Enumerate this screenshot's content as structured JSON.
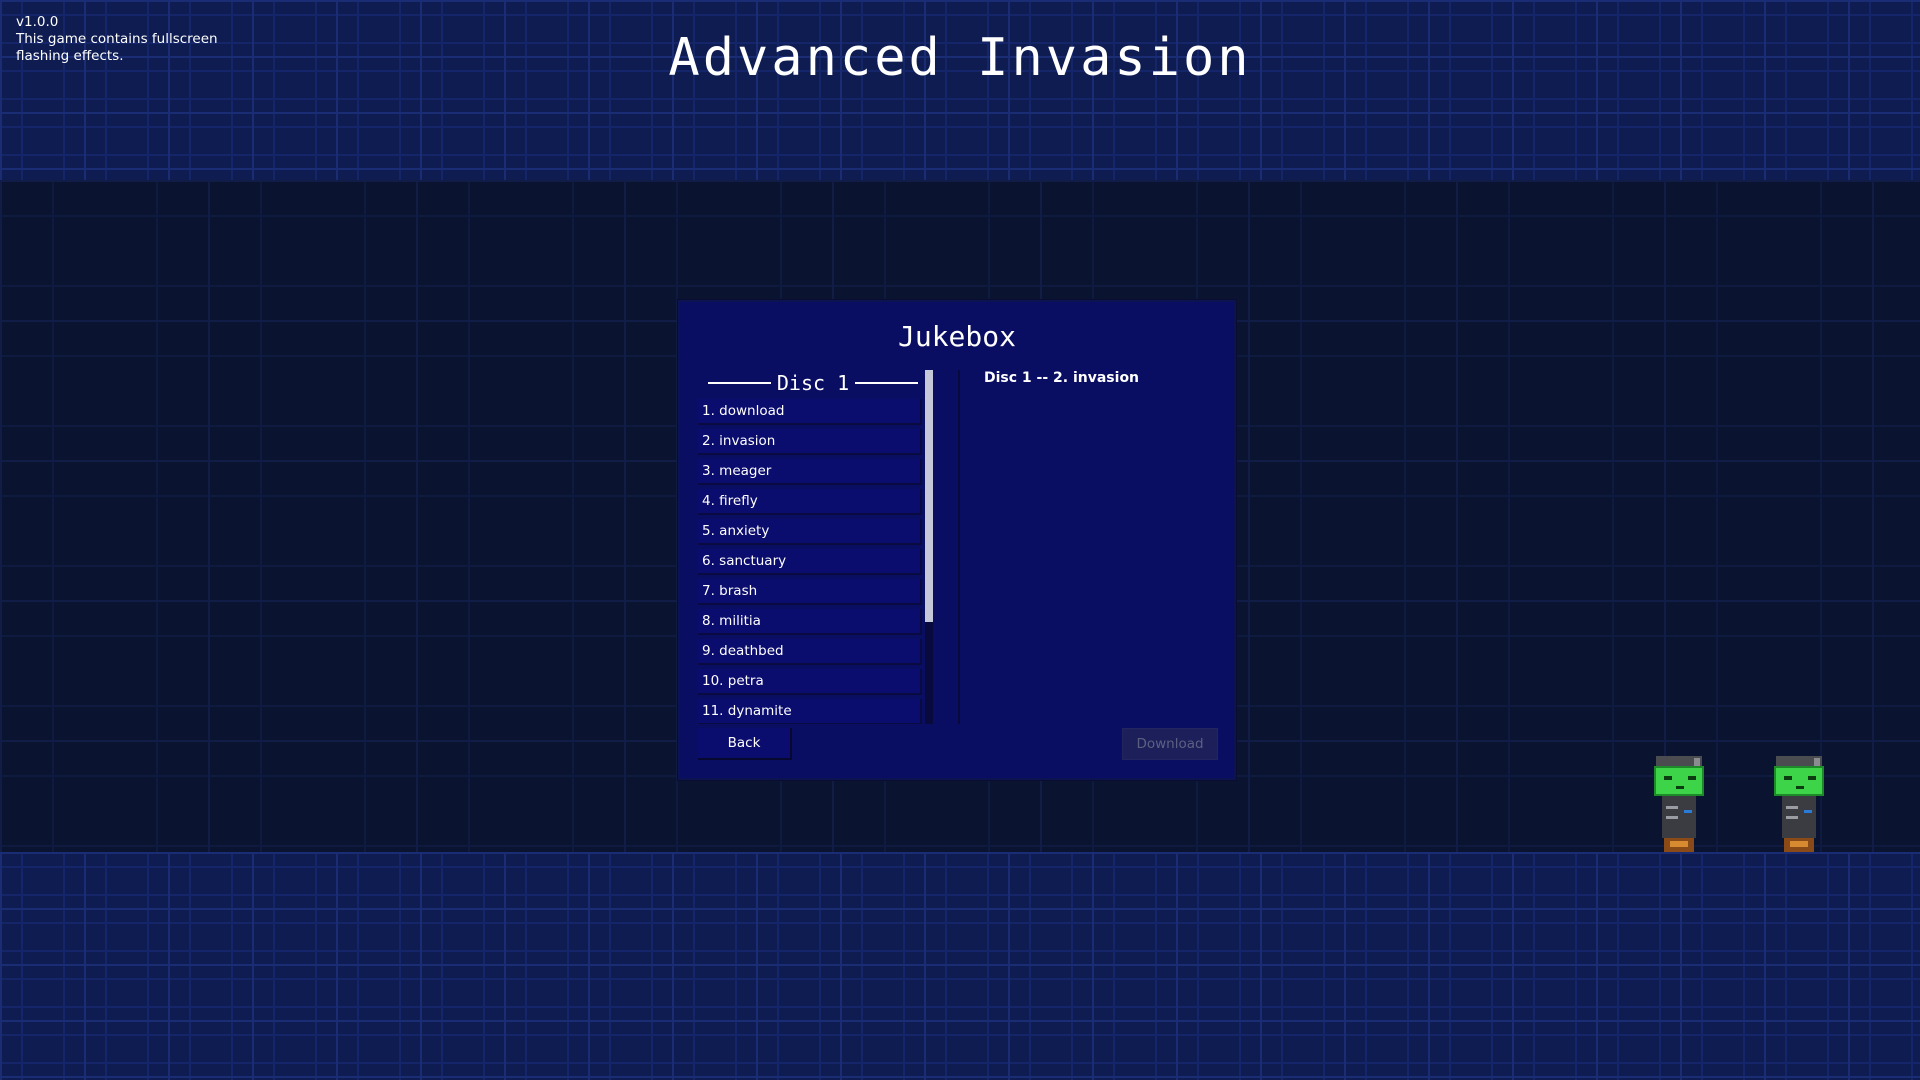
{
  "header": {
    "version": "v1.0.0",
    "warning_line1": "This game contains fullscreen",
    "warning_line2": "flashing effects.",
    "title": "Advanced Invasion"
  },
  "jukebox": {
    "title": "Jukebox",
    "disc_label": "Disc 1",
    "tracks": [
      "1. download",
      "2. invasion",
      "3. meager",
      "4. firefly",
      "5. anxiety",
      "6. sanctuary",
      "7. brash",
      "8. militia",
      "9. deathbed",
      "10. petra",
      "11. dynamite"
    ],
    "now_playing": "Disc 1 -- 2. invasion",
    "back_label": "Back",
    "download_label": "Download",
    "download_enabled": false
  },
  "colors": {
    "panel": "#0a0e62",
    "track_row": "#0a0c6e",
    "robot_head": "#3dd44a"
  },
  "icons": [
    "robot-sprite",
    "robot-sprite"
  ]
}
